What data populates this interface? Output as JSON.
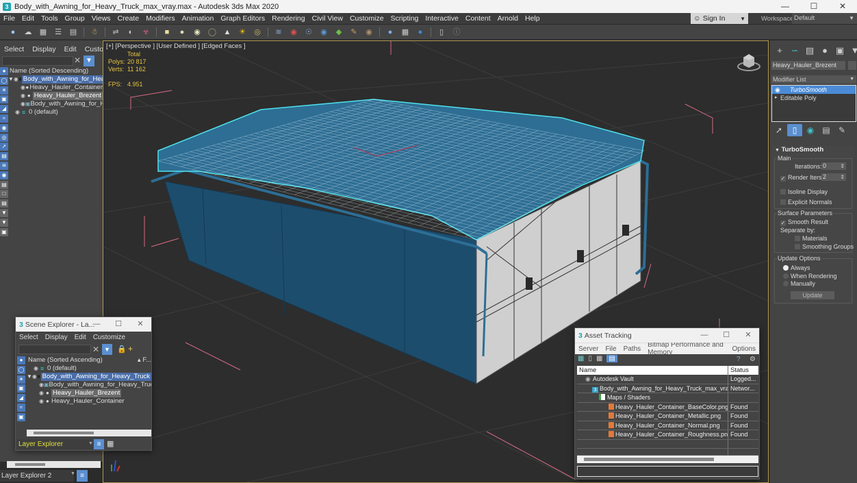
{
  "window": {
    "title": "Body_with_Awning_for_Heavy_Truck_max_vray.max - Autodesk 3ds Max 2020",
    "app_icon": "3ds-max-icon",
    "controls": [
      "minimize",
      "maximize",
      "close"
    ]
  },
  "menubar": {
    "items": [
      "File",
      "Edit",
      "Tools",
      "Group",
      "Views",
      "Create",
      "Modifiers",
      "Animation",
      "Graph Editors",
      "Rendering",
      "Civil View",
      "Customize",
      "Scripting",
      "Interactive",
      "Content",
      "Arnold",
      "Help"
    ],
    "sign_in": "Sign In",
    "workspaces_label": "Workspaces:",
    "workspace": "Default"
  },
  "toolbar": {
    "icons": [
      "undo-scene-icon",
      "cloud-icon",
      "layer-manager-icon",
      "list-icon",
      "toggle-ribbon-icon",
      "select-object-icon",
      "link-icon",
      "unlink-icon",
      "bind-spacewarp-icon",
      "box-icon",
      "sphere-icon",
      "cylinder-icon",
      "torus-icon",
      "cone-icon",
      "light-icon",
      "plane-icon",
      "curve-editor-icon",
      "schematic-view-icon",
      "material-editor-icon",
      "render-setup-icon",
      "render-frame-icon",
      "render-icon",
      "render-iterative-icon",
      "teapot-render-icon",
      "vray-icon",
      "vray-frame-icon",
      "vray-light-icon",
      "viewport-layout-icon",
      "help-icon"
    ]
  },
  "left_explorer": {
    "menu": [
      "Select",
      "Display",
      "Edit",
      "Customize"
    ],
    "header": "Name (Sorted Descending)",
    "rows": [
      {
        "label": "Body_with_Awning_for_Heavy",
        "indent": 0,
        "state": "selected",
        "expanded": true
      },
      {
        "label": "Heavy_Hauler_Container",
        "indent": 1,
        "state": ""
      },
      {
        "label": "Heavy_Hauler_Brezent",
        "indent": 1,
        "state": "highlight"
      },
      {
        "label": "Body_with_Awning_for_Hea",
        "indent": 1,
        "state": ""
      },
      {
        "label": "0 (default)",
        "indent": 0,
        "state": "",
        "layer": true
      }
    ],
    "bottom_label": "Layer Explorer 2"
  },
  "viewport": {
    "label": "[+] [Perspective ] [User Defined ] [Edged Faces ]",
    "stats": {
      "total_label": "Total",
      "polys_label": "Polys:",
      "polys": "20 817",
      "verts_label": "Verts:",
      "verts": "11 162",
      "fps_label": "FPS:",
      "fps": "4.951"
    },
    "model_colors": {
      "awning": "#2e6e94",
      "wire": "#e6f2f8",
      "side": "#1d4d6d",
      "panel": "#cfcfcf",
      "highlight": "#4fe2ee"
    }
  },
  "command_panel": {
    "tabs": [
      "create-icon",
      "modify-icon",
      "hierarchy-icon",
      "motion-icon",
      "display-icon",
      "utilities-icon"
    ],
    "object_name": "Heavy_Hauler_Brezent",
    "modifier_list": "Modifier List",
    "stack": [
      {
        "label": "TurboSmooth",
        "active": true
      },
      {
        "label": "Editable Poly",
        "active": false
      }
    ],
    "stack_tools": [
      "pin-stack-icon",
      "show-end-result-icon",
      "make-unique-icon",
      "remove-modifier-icon",
      "configure-sets-icon"
    ],
    "rollout": {
      "title": "TurboSmooth",
      "main_group": "Main",
      "iterations_label": "Iterations:",
      "iterations": "0",
      "render_iters_label": "Render Iters:",
      "render_iters": "2",
      "render_iters_checked": true,
      "isoline_display": "Isoline Display",
      "explicit_normals": "Explicit Normals",
      "surface_group": "Surface Parameters",
      "smooth_result": "Smooth Result",
      "separate_by": "Separate by:",
      "materials": "Materials",
      "smoothing_groups": "Smoothing Groups",
      "update_group": "Update Options",
      "always": "Always",
      "when_rendering": "When Rendering",
      "manually": "Manually",
      "update_button": "Update"
    }
  },
  "scene_explorer": {
    "title": "Scene Explorer - La...",
    "menu": [
      "Select",
      "Display",
      "Edit",
      "Customize"
    ],
    "header": "Name (Sorted Ascending)",
    "header_right": "▴ F...",
    "rows": [
      {
        "label": "0 (default)",
        "indent": 1,
        "state": "",
        "layer": true
      },
      {
        "label": "Body_with_Awning_for_Heavy_Truck",
        "indent": 0,
        "state": "selected"
      },
      {
        "label": "Body_with_Awning_for_Heavy_Truck",
        "indent": 2,
        "state": ""
      },
      {
        "label": "Heavy_Hauler_Brezent",
        "indent": 2,
        "state": "highlight"
      },
      {
        "label": "Heavy_Hauler_Container",
        "indent": 2,
        "state": ""
      }
    ],
    "footer_label": "Layer Explorer"
  },
  "asset_tracking": {
    "title": "Asset Tracking",
    "menu": [
      "Server",
      "File",
      "Paths",
      "Bitmap Performance and Memory",
      "Options"
    ],
    "columns": [
      "Name",
      "Status"
    ],
    "rows": [
      {
        "name": "Autodesk Vault",
        "status": "Logged...",
        "type": "vault"
      },
      {
        "name": "Body_with_Awning_for_Heavy_Truck_max_vray.max",
        "status": "Networ...",
        "type": "max"
      },
      {
        "name": "Maps / Shaders",
        "status": "",
        "type": "maps"
      },
      {
        "name": "Heavy_Hauler_Container_BaseColor.png",
        "status": "Found",
        "type": "png"
      },
      {
        "name": "Heavy_Hauler_Container_Metallic.png",
        "status": "Found",
        "type": "png"
      },
      {
        "name": "Heavy_Hauler_Container_Normal.png",
        "status": "Found",
        "type": "png"
      },
      {
        "name": "Heavy_Hauler_Container_Roughness.png",
        "status": "Found",
        "type": "png"
      }
    ]
  }
}
